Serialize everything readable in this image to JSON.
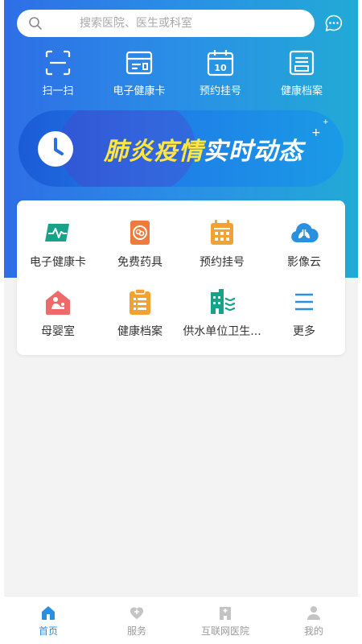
{
  "search": {
    "placeholder": "搜索医院、医生或科室"
  },
  "quick_actions": [
    {
      "label": "扫一扫",
      "icon": "scan-icon"
    },
    {
      "label": "电子健康卡",
      "icon": "card-icon"
    },
    {
      "label": "预约挂号",
      "icon": "calendar-icon"
    },
    {
      "label": "健康档案",
      "icon": "folder-icon"
    }
  ],
  "banner": {
    "title_part1": "肺炎疫情",
    "title_part2": "实时动态",
    "highlight_color": "#ffe642"
  },
  "services": [
    {
      "label": "电子健康卡",
      "icon": "health-card-icon",
      "color": "#19a28a"
    },
    {
      "label": "免费药具",
      "icon": "medicine-box-icon",
      "color": "#ee7b3b"
    },
    {
      "label": "预约挂号",
      "icon": "calendar-icon",
      "color": "#f2a233"
    },
    {
      "label": "影像云",
      "icon": "cloud-lungs-icon",
      "color": "#2b8fe0"
    },
    {
      "label": "母婴室",
      "icon": "mother-baby-room-icon",
      "color": "#ee6a6a"
    },
    {
      "label": "健康档案",
      "icon": "clipboard-icon",
      "color": "#f2a233"
    },
    {
      "label": "供水单位卫生...",
      "icon": "building-icon",
      "color": "#19a28a"
    },
    {
      "label": "更多",
      "icon": "menu-icon",
      "color": "#2b8fe0"
    }
  ],
  "tabs": [
    {
      "label": "首页",
      "icon": "home-icon",
      "active": true
    },
    {
      "label": "服务",
      "icon": "heart-icon",
      "active": false
    },
    {
      "label": "互联网医院",
      "icon": "hospital-icon",
      "active": false
    },
    {
      "label": "我的",
      "icon": "user-icon",
      "active": false
    }
  ],
  "colors": {
    "accent": "#2b8fe0",
    "tab_inactive": "#9a9a9a",
    "hero_start": "#2e6ee6",
    "hero_end": "#22aad6"
  }
}
